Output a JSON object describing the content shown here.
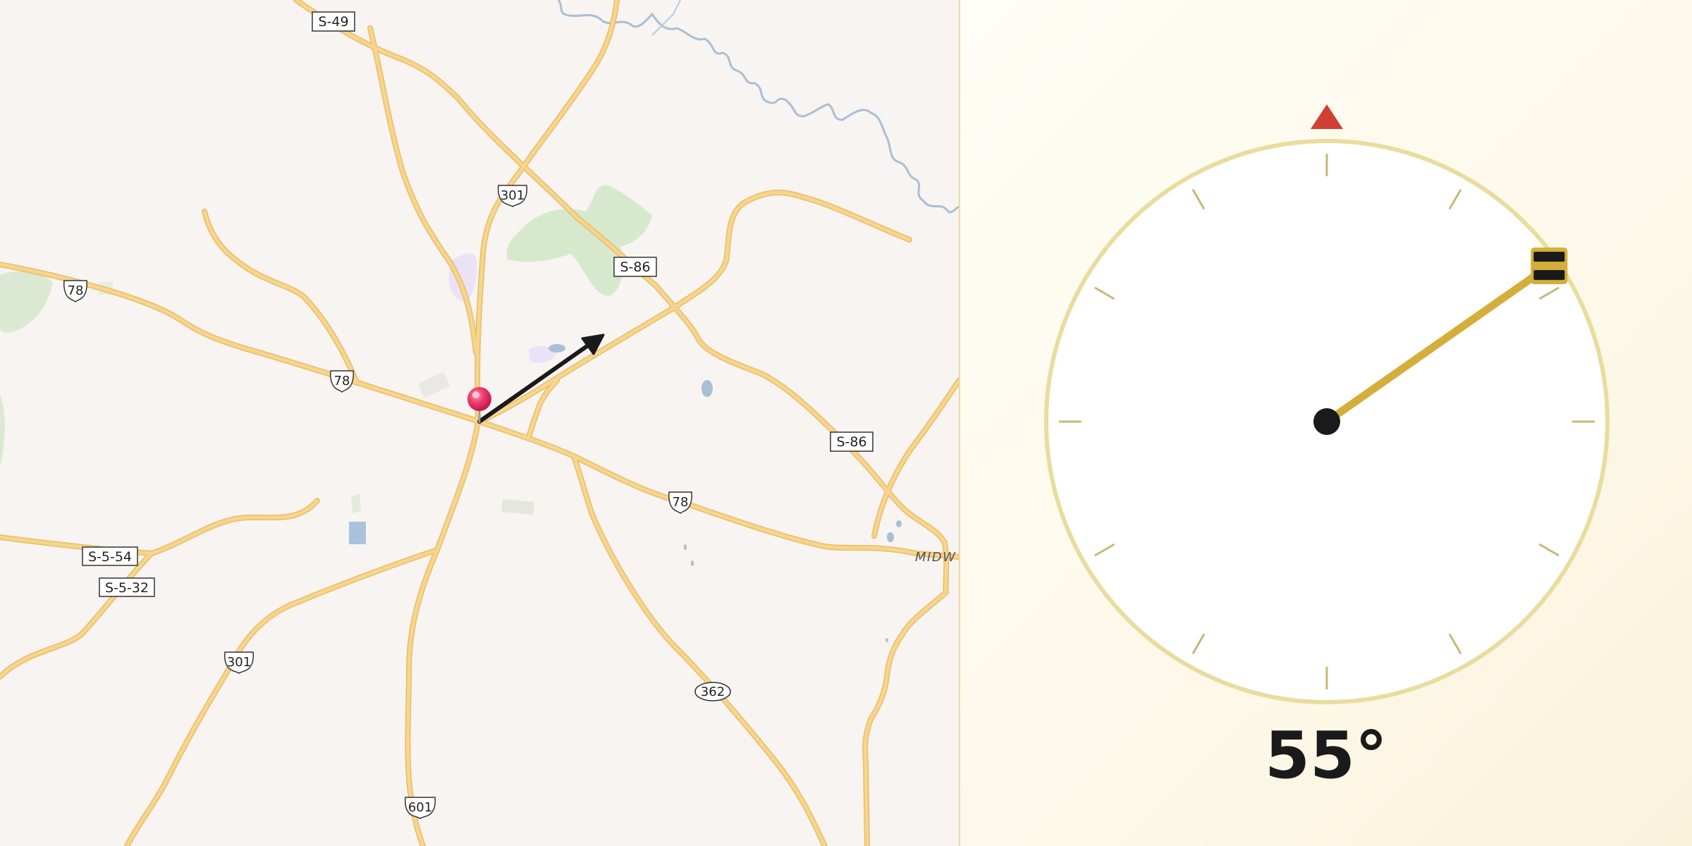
{
  "map": {
    "route_labels": [
      {
        "id": "s-49",
        "text": "S-49",
        "kind": "box"
      },
      {
        "id": "us-301-north",
        "text": "301",
        "kind": "us-shield"
      },
      {
        "id": "s-86-upper",
        "text": "S-86",
        "kind": "box"
      },
      {
        "id": "us-78-west",
        "text": "78",
        "kind": "us-shield"
      },
      {
        "id": "us-78-center",
        "text": "78",
        "kind": "us-shield"
      },
      {
        "id": "s-86-lower",
        "text": "S-86",
        "kind": "box"
      },
      {
        "id": "us-78-east",
        "text": "78",
        "kind": "us-shield"
      },
      {
        "id": "s-5-54",
        "text": "S-5-54",
        "kind": "box"
      },
      {
        "id": "s-5-32",
        "text": "S-5-32",
        "kind": "box"
      },
      {
        "id": "us-301-south",
        "text": "301",
        "kind": "us-shield"
      },
      {
        "id": "sc-362",
        "text": "362",
        "kind": "state-shield"
      },
      {
        "id": "us-601",
        "text": "601",
        "kind": "us-shield"
      }
    ],
    "place_label": "MIDW",
    "pin_icon": "map-pin-icon",
    "direction_icon": "direction-arrow-icon",
    "colors": {
      "land": "#f7f4f1",
      "road": "#f7d58c",
      "road_casing": "#e8bd6a",
      "water": "#a8bfd6",
      "park": "#d6e9cc",
      "pin": "#e8336b"
    }
  },
  "compass": {
    "heading_degrees": 55,
    "heading_text": "55°",
    "north_marker_icon": "north-triangle-icon",
    "needle_handle_icon": "needle-handle-icon",
    "colors": {
      "ring": "#e8dd9e",
      "needle": "#d4ae3b",
      "north_marker": "#d13f33",
      "ticks": "#c9b679"
    }
  }
}
